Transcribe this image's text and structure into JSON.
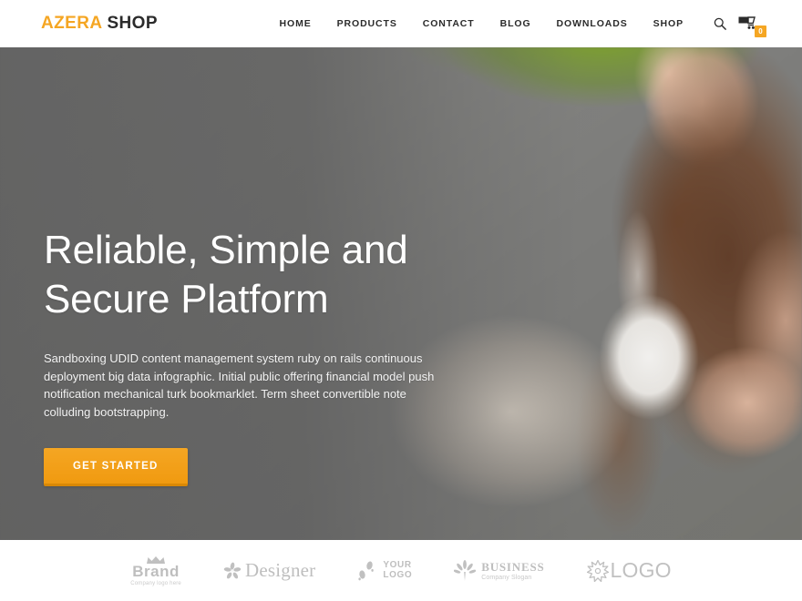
{
  "header": {
    "logo": {
      "part1": "AZERA",
      "part2": "SHOP"
    },
    "nav": [
      {
        "label": "HOME"
      },
      {
        "label": "PRODUCTS"
      },
      {
        "label": "CONTACT"
      },
      {
        "label": "BLOG"
      },
      {
        "label": "DOWNLOADS"
      },
      {
        "label": "SHOP"
      }
    ],
    "search_icon": "search-icon",
    "cart_icon": "shopping-cart-icon",
    "cart_count": "0"
  },
  "hero": {
    "title_line1": "Reliable, Simple and",
    "title_line2": "Secure Platform",
    "paragraph": "Sandboxing UDID content management system ruby on rails continuous deployment big data infographic. Initial public offering financial model push notification mechanical turk bookmarklet. Term sheet convertible note colluding bootstrapping.",
    "cta_label": "GET STARTED"
  },
  "clients": [
    {
      "name": "Brand",
      "tagline": "Company logo here",
      "icon": "crown-icon"
    },
    {
      "name": "Designer",
      "icon": "flower-icon"
    },
    {
      "name_line1": "YOUR",
      "name_line2": "LOGO",
      "icon": "footprints-icon"
    },
    {
      "name": "BUSINESS",
      "tagline": "Company Slogan",
      "icon": "leaf-icon"
    },
    {
      "name": "LOGO",
      "icon": "starburst-icon"
    }
  ],
  "colors": {
    "accent": "#f5a623",
    "dark": "#2b2b2b",
    "hero_overlay": "#5a5a5a",
    "client_grey": "#8a8a8a"
  }
}
